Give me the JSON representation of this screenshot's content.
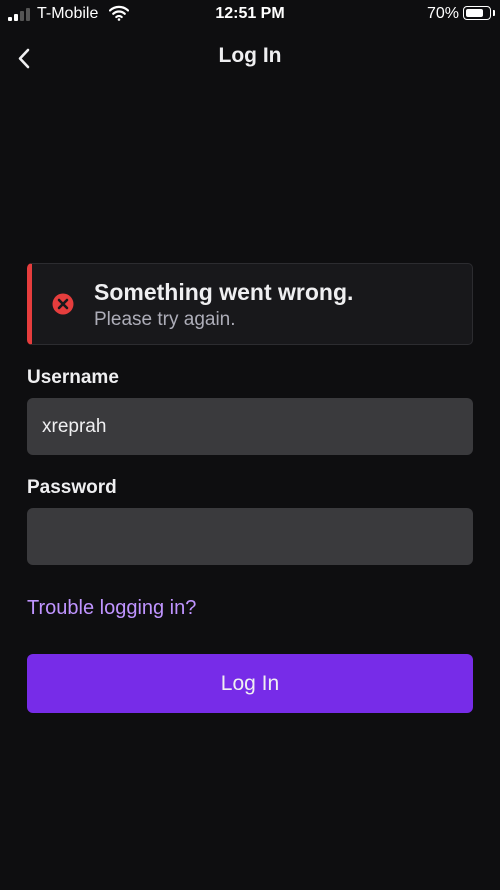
{
  "status_bar": {
    "carrier": "T-Mobile",
    "time": "12:51 PM",
    "battery_percent": "70%",
    "battery_level": 0.7,
    "signal_bars": 2,
    "icons": [
      "signal-icon",
      "wifi-icon",
      "battery-icon"
    ]
  },
  "header": {
    "title": "Log In",
    "back_icon": "chevron-left-icon"
  },
  "error_banner": {
    "title": "Something went wrong.",
    "message": "Please try again.",
    "icon": "error-x-icon",
    "accent_color": "#e53d3d"
  },
  "form": {
    "username_label": "Username",
    "username_value": "xreprah",
    "password_label": "Password",
    "password_value": "",
    "trouble_link": "Trouble logging in?",
    "login_button": "Log In"
  },
  "colors": {
    "background": "#0e0e10",
    "brand_purple": "#772ce8",
    "link_purple": "#bf94ff",
    "input_bg": "#3a3a3d"
  }
}
